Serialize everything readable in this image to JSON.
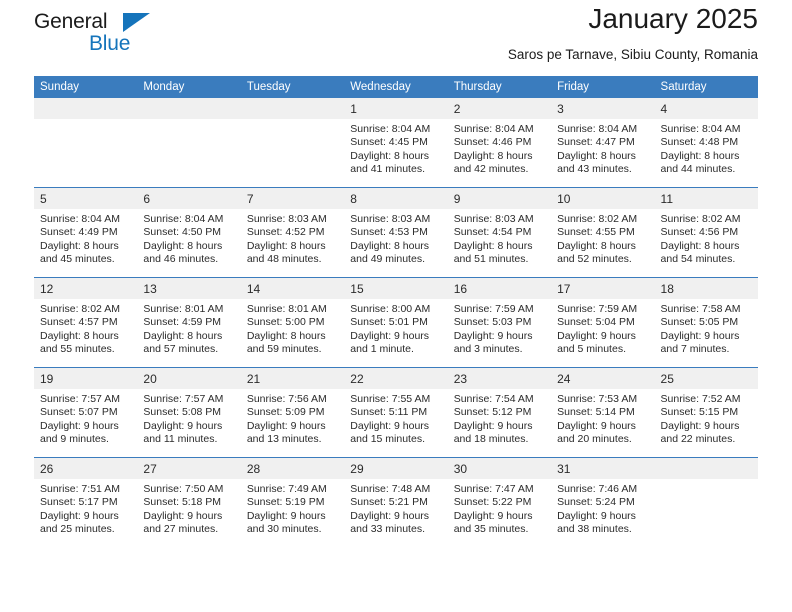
{
  "brand": {
    "word_one": "General",
    "word_two": "Blue",
    "triangle_color": "#1574bb",
    "blue_color": "#1574bb"
  },
  "header": {
    "month_title": "January 2025",
    "location": "Saros pe Tarnave, Sibiu County, Romania"
  },
  "theme": {
    "header_blue": "#3a7cbe",
    "daynum_bg": "#f0f0f0",
    "text": "#2b2b2b",
    "page_bg": "#ffffff"
  },
  "weekday_headers": [
    "Sunday",
    "Monday",
    "Tuesday",
    "Wednesday",
    "Thursday",
    "Friday",
    "Saturday"
  ],
  "weeks": [
    [
      {
        "day": "",
        "blank": true,
        "sunrise": "",
        "sunset": "",
        "daylight_1": "",
        "daylight_2": ""
      },
      {
        "day": "",
        "blank": true,
        "sunrise": "",
        "sunset": "",
        "daylight_1": "",
        "daylight_2": ""
      },
      {
        "day": "",
        "blank": true,
        "sunrise": "",
        "sunset": "",
        "daylight_1": "",
        "daylight_2": ""
      },
      {
        "day": "1",
        "sunrise": "Sunrise: 8:04 AM",
        "sunset": "Sunset: 4:45 PM",
        "daylight_1": "Daylight: 8 hours",
        "daylight_2": "and 41 minutes."
      },
      {
        "day": "2",
        "sunrise": "Sunrise: 8:04 AM",
        "sunset": "Sunset: 4:46 PM",
        "daylight_1": "Daylight: 8 hours",
        "daylight_2": "and 42 minutes."
      },
      {
        "day": "3",
        "sunrise": "Sunrise: 8:04 AM",
        "sunset": "Sunset: 4:47 PM",
        "daylight_1": "Daylight: 8 hours",
        "daylight_2": "and 43 minutes."
      },
      {
        "day": "4",
        "sunrise": "Sunrise: 8:04 AM",
        "sunset": "Sunset: 4:48 PM",
        "daylight_1": "Daylight: 8 hours",
        "daylight_2": "and 44 minutes."
      }
    ],
    [
      {
        "day": "5",
        "sunrise": "Sunrise: 8:04 AM",
        "sunset": "Sunset: 4:49 PM",
        "daylight_1": "Daylight: 8 hours",
        "daylight_2": "and 45 minutes."
      },
      {
        "day": "6",
        "sunrise": "Sunrise: 8:04 AM",
        "sunset": "Sunset: 4:50 PM",
        "daylight_1": "Daylight: 8 hours",
        "daylight_2": "and 46 minutes."
      },
      {
        "day": "7",
        "sunrise": "Sunrise: 8:03 AM",
        "sunset": "Sunset: 4:52 PM",
        "daylight_1": "Daylight: 8 hours",
        "daylight_2": "and 48 minutes."
      },
      {
        "day": "8",
        "sunrise": "Sunrise: 8:03 AM",
        "sunset": "Sunset: 4:53 PM",
        "daylight_1": "Daylight: 8 hours",
        "daylight_2": "and 49 minutes."
      },
      {
        "day": "9",
        "sunrise": "Sunrise: 8:03 AM",
        "sunset": "Sunset: 4:54 PM",
        "daylight_1": "Daylight: 8 hours",
        "daylight_2": "and 51 minutes."
      },
      {
        "day": "10",
        "sunrise": "Sunrise: 8:02 AM",
        "sunset": "Sunset: 4:55 PM",
        "daylight_1": "Daylight: 8 hours",
        "daylight_2": "and 52 minutes."
      },
      {
        "day": "11",
        "sunrise": "Sunrise: 8:02 AM",
        "sunset": "Sunset: 4:56 PM",
        "daylight_1": "Daylight: 8 hours",
        "daylight_2": "and 54 minutes."
      }
    ],
    [
      {
        "day": "12",
        "sunrise": "Sunrise: 8:02 AM",
        "sunset": "Sunset: 4:57 PM",
        "daylight_1": "Daylight: 8 hours",
        "daylight_2": "and 55 minutes."
      },
      {
        "day": "13",
        "sunrise": "Sunrise: 8:01 AM",
        "sunset": "Sunset: 4:59 PM",
        "daylight_1": "Daylight: 8 hours",
        "daylight_2": "and 57 minutes."
      },
      {
        "day": "14",
        "sunrise": "Sunrise: 8:01 AM",
        "sunset": "Sunset: 5:00 PM",
        "daylight_1": "Daylight: 8 hours",
        "daylight_2": "and 59 minutes."
      },
      {
        "day": "15",
        "sunrise": "Sunrise: 8:00 AM",
        "sunset": "Sunset: 5:01 PM",
        "daylight_1": "Daylight: 9 hours",
        "daylight_2": "and 1 minute."
      },
      {
        "day": "16",
        "sunrise": "Sunrise: 7:59 AM",
        "sunset": "Sunset: 5:03 PM",
        "daylight_1": "Daylight: 9 hours",
        "daylight_2": "and 3 minutes."
      },
      {
        "day": "17",
        "sunrise": "Sunrise: 7:59 AM",
        "sunset": "Sunset: 5:04 PM",
        "daylight_1": "Daylight: 9 hours",
        "daylight_2": "and 5 minutes."
      },
      {
        "day": "18",
        "sunrise": "Sunrise: 7:58 AM",
        "sunset": "Sunset: 5:05 PM",
        "daylight_1": "Daylight: 9 hours",
        "daylight_2": "and 7 minutes."
      }
    ],
    [
      {
        "day": "19",
        "sunrise": "Sunrise: 7:57 AM",
        "sunset": "Sunset: 5:07 PM",
        "daylight_1": "Daylight: 9 hours",
        "daylight_2": "and 9 minutes."
      },
      {
        "day": "20",
        "sunrise": "Sunrise: 7:57 AM",
        "sunset": "Sunset: 5:08 PM",
        "daylight_1": "Daylight: 9 hours",
        "daylight_2": "and 11 minutes."
      },
      {
        "day": "21",
        "sunrise": "Sunrise: 7:56 AM",
        "sunset": "Sunset: 5:09 PM",
        "daylight_1": "Daylight: 9 hours",
        "daylight_2": "and 13 minutes."
      },
      {
        "day": "22",
        "sunrise": "Sunrise: 7:55 AM",
        "sunset": "Sunset: 5:11 PM",
        "daylight_1": "Daylight: 9 hours",
        "daylight_2": "and 15 minutes."
      },
      {
        "day": "23",
        "sunrise": "Sunrise: 7:54 AM",
        "sunset": "Sunset: 5:12 PM",
        "daylight_1": "Daylight: 9 hours",
        "daylight_2": "and 18 minutes."
      },
      {
        "day": "24",
        "sunrise": "Sunrise: 7:53 AM",
        "sunset": "Sunset: 5:14 PM",
        "daylight_1": "Daylight: 9 hours",
        "daylight_2": "and 20 minutes."
      },
      {
        "day": "25",
        "sunrise": "Sunrise: 7:52 AM",
        "sunset": "Sunset: 5:15 PM",
        "daylight_1": "Daylight: 9 hours",
        "daylight_2": "and 22 minutes."
      }
    ],
    [
      {
        "day": "26",
        "sunrise": "Sunrise: 7:51 AM",
        "sunset": "Sunset: 5:17 PM",
        "daylight_1": "Daylight: 9 hours",
        "daylight_2": "and 25 minutes."
      },
      {
        "day": "27",
        "sunrise": "Sunrise: 7:50 AM",
        "sunset": "Sunset: 5:18 PM",
        "daylight_1": "Daylight: 9 hours",
        "daylight_2": "and 27 minutes."
      },
      {
        "day": "28",
        "sunrise": "Sunrise: 7:49 AM",
        "sunset": "Sunset: 5:19 PM",
        "daylight_1": "Daylight: 9 hours",
        "daylight_2": "and 30 minutes."
      },
      {
        "day": "29",
        "sunrise": "Sunrise: 7:48 AM",
        "sunset": "Sunset: 5:21 PM",
        "daylight_1": "Daylight: 9 hours",
        "daylight_2": "and 33 minutes."
      },
      {
        "day": "30",
        "sunrise": "Sunrise: 7:47 AM",
        "sunset": "Sunset: 5:22 PM",
        "daylight_1": "Daylight: 9 hours",
        "daylight_2": "and 35 minutes."
      },
      {
        "day": "31",
        "sunrise": "Sunrise: 7:46 AM",
        "sunset": "Sunset: 5:24 PM",
        "daylight_1": "Daylight: 9 hours",
        "daylight_2": "and 38 minutes."
      },
      {
        "day": "",
        "blank": true,
        "sunrise": "",
        "sunset": "",
        "daylight_1": "",
        "daylight_2": ""
      }
    ]
  ]
}
